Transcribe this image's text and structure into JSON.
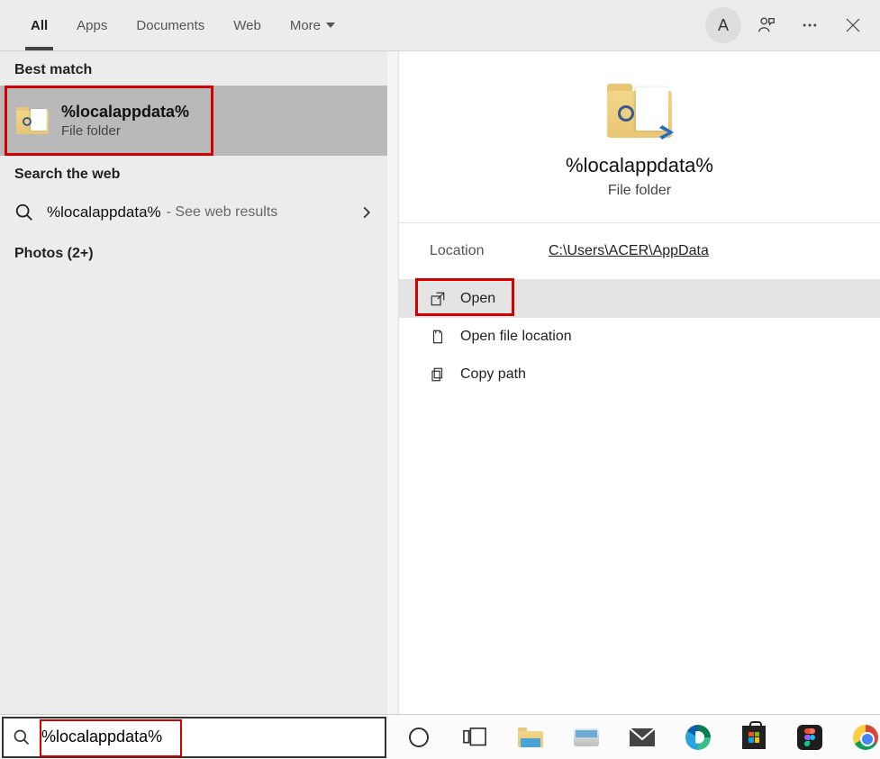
{
  "header": {
    "tabs": [
      "All",
      "Apps",
      "Documents",
      "Web",
      "More"
    ],
    "active_tab": 0,
    "avatar_letter": "A"
  },
  "left": {
    "best_match_label": "Best match",
    "best_match": {
      "title": "%localappdata%",
      "subtitle": "File folder"
    },
    "search_web_label": "Search the web",
    "web_result": {
      "query": "%localappdata%",
      "suffix": " - See web results"
    },
    "photos_label": "Photos (2+)"
  },
  "detail": {
    "title": "%localappdata%",
    "subtitle": "File folder",
    "location_label": "Location",
    "location_path": "C:\\Users\\ACER\\AppData",
    "actions": {
      "open": "Open",
      "open_location": "Open file location",
      "copy_path": "Copy path"
    }
  },
  "search": {
    "value": "%localappdata%"
  }
}
